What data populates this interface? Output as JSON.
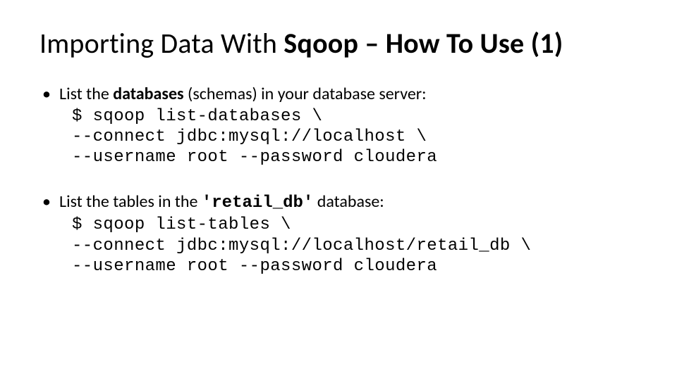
{
  "title": {
    "pre": "Importing Data With ",
    "bold": "Sqoop – How To Use (1)"
  },
  "bullets": [
    {
      "intro_pre": "List the ",
      "intro_bold": "databases",
      "intro_post": " (schemas) in your database server:",
      "code": "$ sqoop list-databases \\\n--connect jdbc:mysql://localhost \\\n--username root --password cloudera"
    },
    {
      "intro_pre": "List the tables in the ",
      "intro_mono": "'retail_db'",
      "intro_post": " database:",
      "code": "$ sqoop list-tables \\\n--connect jdbc:mysql://localhost/retail_db \\\n--username root --password cloudera"
    }
  ]
}
